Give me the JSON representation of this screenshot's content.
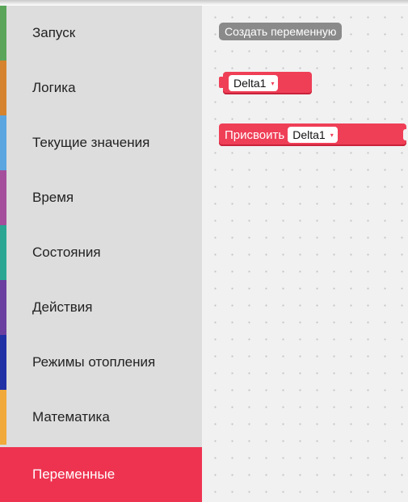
{
  "toolbox": {
    "categories": [
      {
        "label": "Запуск",
        "color": "#5ba55b"
      },
      {
        "label": "Логика",
        "color": "#d5832e"
      },
      {
        "label": "Текущие значения",
        "color": "#5ba5e0"
      },
      {
        "label": "Время",
        "color": "#a54e9b"
      },
      {
        "label": "Состояния",
        "color": "#2aa693"
      },
      {
        "label": "Действия",
        "color": "#6b3fa0"
      },
      {
        "label": "Режимы отопления",
        "color": "#2031a6"
      },
      {
        "label": "Математика",
        "color": "#f0a93a"
      },
      {
        "label": "Переменные",
        "color": "#ee3350",
        "selected": true
      }
    ]
  },
  "flyout": {
    "create_variable_button": "Создать переменную",
    "getter_block": {
      "variable": "Delta1",
      "arrow": "▾"
    },
    "setter_block": {
      "keyword": "Присвоить",
      "variable": "Delta1",
      "arrow": "▾"
    },
    "block_color": "#ef3f57"
  }
}
